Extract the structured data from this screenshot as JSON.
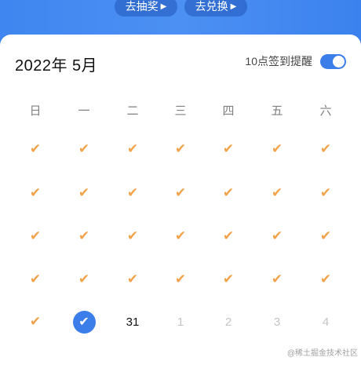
{
  "top_buttons": [
    {
      "label": "去抽奖",
      "arrow": "▶"
    },
    {
      "label": "去兑换",
      "arrow": "▶"
    }
  ],
  "calendar": {
    "title": "2022年 5月",
    "reminder_label": "10点签到提醒",
    "reminder_on": true,
    "weekdays": [
      "日",
      "一",
      "二",
      "三",
      "四",
      "五",
      "六"
    ],
    "check_mark": "✔",
    "today_mark": "✔",
    "days": [
      {
        "state": "checked"
      },
      {
        "state": "checked"
      },
      {
        "state": "checked"
      },
      {
        "state": "checked"
      },
      {
        "state": "checked"
      },
      {
        "state": "checked"
      },
      {
        "state": "checked"
      },
      {
        "state": "checked"
      },
      {
        "state": "checked"
      },
      {
        "state": "checked"
      },
      {
        "state": "checked"
      },
      {
        "state": "checked"
      },
      {
        "state": "checked"
      },
      {
        "state": "checked"
      },
      {
        "state": "checked"
      },
      {
        "state": "checked"
      },
      {
        "state": "checked"
      },
      {
        "state": "checked"
      },
      {
        "state": "checked"
      },
      {
        "state": "checked"
      },
      {
        "state": "checked"
      },
      {
        "state": "checked"
      },
      {
        "state": "checked"
      },
      {
        "state": "checked"
      },
      {
        "state": "checked"
      },
      {
        "state": "checked"
      },
      {
        "state": "checked"
      },
      {
        "state": "checked"
      },
      {
        "state": "checked"
      },
      {
        "state": "today-checked"
      },
      {
        "state": "number",
        "label": "31"
      },
      {
        "state": "future",
        "label": "1"
      },
      {
        "state": "future",
        "label": "2"
      },
      {
        "state": "future",
        "label": "3"
      },
      {
        "state": "future",
        "label": "4"
      }
    ]
  },
  "watermark": "@稀土掘金技术社区",
  "colors": {
    "accent": "#3b7de9",
    "check": "#f0a34b",
    "future_text": "#c4c4c4"
  }
}
